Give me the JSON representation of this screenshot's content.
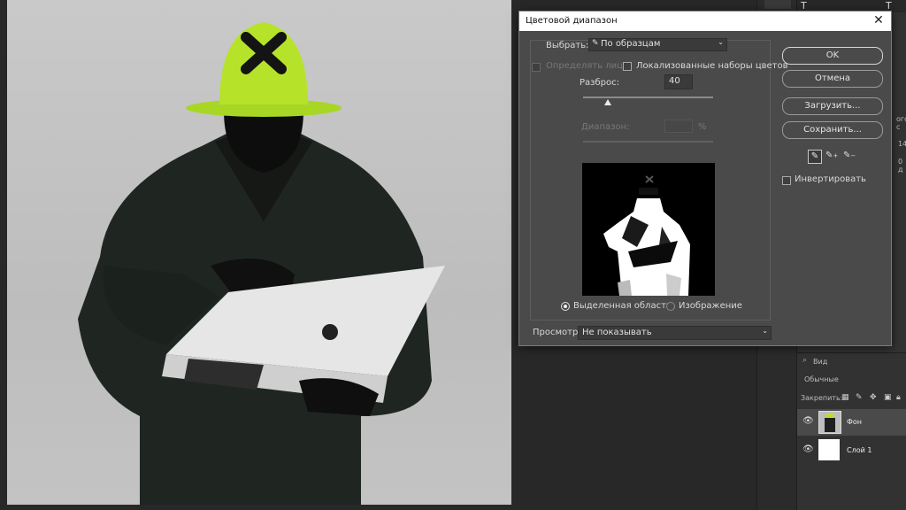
{
  "dialog": {
    "title": "Цветовой диапазон",
    "select_label": "Выбрать:",
    "select_value": "По образцам",
    "detect_faces_label": "Определять лица",
    "localized_sets_label": "Локализованные наборы цветов",
    "fuzziness_label": "Разброс:",
    "fuzziness_value": "40",
    "fuzziness_level": 0.19,
    "range_label": "Диапазон:",
    "range_unit": "%",
    "radio_selection_label": "Выделенная область",
    "radio_image_label": "Изображение",
    "preview_label": "Просмотр:",
    "preview_value": "Не показывать",
    "buttons": {
      "ok": "OK",
      "cancel": "Отмена",
      "load": "Загрузить...",
      "save": "Сохранить..."
    },
    "invert_label": "Инвертировать"
  },
  "layers_panel": {
    "search_placeholder": "Вид",
    "blend_mode": "Обычные",
    "lock_label": "Закрепить:",
    "layers": [
      {
        "name": "Фон"
      },
      {
        "name": "Слой 1"
      }
    ]
  },
  "right_edge": {
    "value_1": "14",
    "value_2": "0 д",
    "tab_fragment": "ого с"
  },
  "colors": {
    "hat": "#b6e32a",
    "dialog_bg": "#4a4a4a",
    "app_bg": "#282828"
  }
}
